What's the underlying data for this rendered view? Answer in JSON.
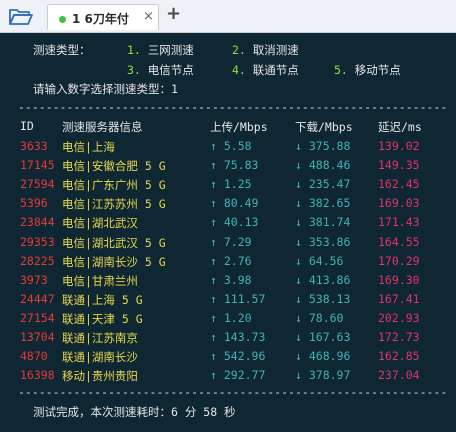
{
  "tab": {
    "title": "1 6刀年付",
    "close": "×",
    "add": "+"
  },
  "menu": {
    "label": "测速类型：",
    "opt1_num": "1.",
    "opt1": "三网测速",
    "opt2_num": "2.",
    "opt2": "取消测速",
    "opt3_num": "3.",
    "opt3": "电信节点",
    "opt4_num": "4.",
    "opt4": "联通节点",
    "opt5_num": "5.",
    "opt5": "移动节点",
    "prompt": "请输入数字选择测速类型：1"
  },
  "separator": "--------------------------------------------------------------",
  "headers": {
    "id": "ID",
    "server": "测速服务器信息",
    "upload": "上传/Mbps",
    "download": "下载/Mbps",
    "latency": "延迟/ms"
  },
  "rows": [
    {
      "id": "3633",
      "server": "电信|上海",
      "up": "↑ 5.58",
      "down": "↓ 375.88",
      "ping": "139.02"
    },
    {
      "id": "17145",
      "server": "电信|安徽合肥 5 G",
      "up": "↑ 75.83",
      "down": "↓ 488.46",
      "ping": "149.35"
    },
    {
      "id": "27594",
      "server": "电信|广东广州 5 G",
      "up": "↑ 1.25",
      "down": "↓ 235.47",
      "ping": "162.45"
    },
    {
      "id": "5396",
      "server": "电信|江苏苏州 5 G",
      "up": "↑ 80.49",
      "down": "↓ 382.65",
      "ping": "169.03"
    },
    {
      "id": "23844",
      "server": "电信|湖北武汉",
      "up": "↑ 40.13",
      "down": "↓ 381.74",
      "ping": "171.43"
    },
    {
      "id": "29353",
      "server": "电信|湖北武汉 5 G",
      "up": "↑ 7.29",
      "down": "↓ 353.86",
      "ping": "164.55"
    },
    {
      "id": "28225",
      "server": "电信|湖南长沙 5 G",
      "up": "↑ 2.76",
      "down": "↓ 64.56",
      "ping": "170.29"
    },
    {
      "id": "3973",
      "server": "电信|甘肃兰州",
      "up": "↑ 3.98",
      "down": "↓ 413.86",
      "ping": "169.30"
    },
    {
      "id": "24447",
      "server": "联通|上海 5 G",
      "up": "↑ 111.57",
      "down": "↓ 538.13",
      "ping": "167.41"
    },
    {
      "id": "27154",
      "server": "联通|天津 5 G",
      "up": "↑ 1.20",
      "down": "↓ 78.60",
      "ping": "202.93"
    },
    {
      "id": "13704",
      "server": "联通|江苏南京",
      "up": "↑ 143.73",
      "down": "↓ 167.63",
      "ping": "172.73"
    },
    {
      "id": "4870",
      "server": "联通|湖南长沙",
      "up": "↑ 542.96",
      "down": "↓ 468.96",
      "ping": "162.85"
    },
    {
      "id": "16398",
      "server": "移动|贵州贵阳",
      "up": "↑ 292.77",
      "down": "↓ 378.97",
      "ping": "237.04"
    }
  ],
  "footer": "测试完成，本次测速耗时：6 分 58 秒",
  "colors": {
    "terminal_bg": "#0f2733",
    "id": "#e83a3a",
    "server": "#e8d84a",
    "upload": "#3fb4b4",
    "download": "#3fb4b4",
    "latency": "#e0346a",
    "option": "#8fe23b"
  }
}
